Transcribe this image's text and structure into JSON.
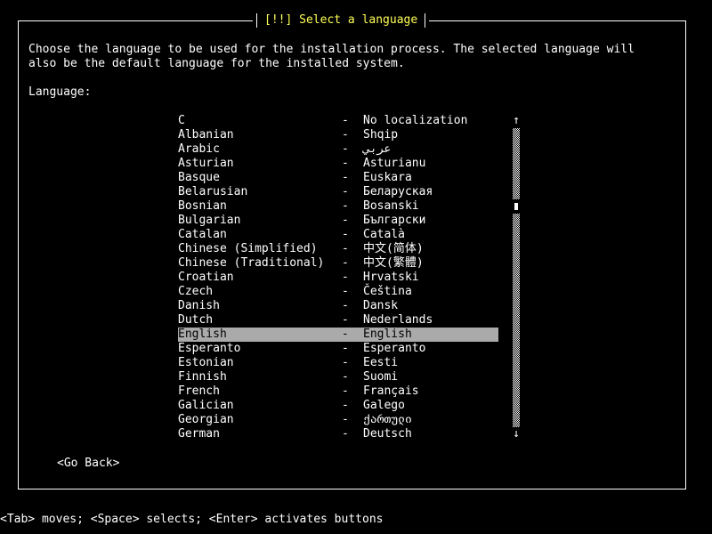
{
  "dialog": {
    "title": "[!!] Select a language",
    "description_line1": "Choose the language to be used for the installation process. The selected language will",
    "description_line2": "also be the default language for the installed system.",
    "list_label": "Language:"
  },
  "languages": [
    {
      "name": "C",
      "native": "No localization"
    },
    {
      "name": "Albanian",
      "native": "Shqip"
    },
    {
      "name": "Arabic",
      "native": "عربي"
    },
    {
      "name": "Asturian",
      "native": "Asturianu"
    },
    {
      "name": "Basque",
      "native": "Euskara"
    },
    {
      "name": "Belarusian",
      "native": "Беларуская"
    },
    {
      "name": "Bosnian",
      "native": "Bosanski"
    },
    {
      "name": "Bulgarian",
      "native": "Български"
    },
    {
      "name": "Catalan",
      "native": "Català"
    },
    {
      "name": "Chinese (Simplified)",
      "native": "中文(简体)"
    },
    {
      "name": "Chinese (Traditional)",
      "native": "中文(繁體)"
    },
    {
      "name": "Croatian",
      "native": "Hrvatski"
    },
    {
      "name": "Czech",
      "native": "Čeština"
    },
    {
      "name": "Danish",
      "native": "Dansk"
    },
    {
      "name": "Dutch",
      "native": "Nederlands"
    },
    {
      "name": "English",
      "native": "English",
      "selected": true
    },
    {
      "name": "Esperanto",
      "native": "Esperanto"
    },
    {
      "name": "Estonian",
      "native": "Eesti"
    },
    {
      "name": "Finnish",
      "native": "Suomi"
    },
    {
      "name": "French",
      "native": "Français"
    },
    {
      "name": "Galician",
      "native": "Galego"
    },
    {
      "name": "Georgian",
      "native": "ქართული"
    },
    {
      "name": "German",
      "native": "Deutsch"
    }
  ],
  "separator": "-",
  "scrollbar": {
    "up_icon": "↑",
    "down_icon": "↓"
  },
  "buttons": {
    "go_back": "<Go Back>"
  },
  "help_line": "<Tab> moves; <Space> selects; <Enter> activates buttons"
}
